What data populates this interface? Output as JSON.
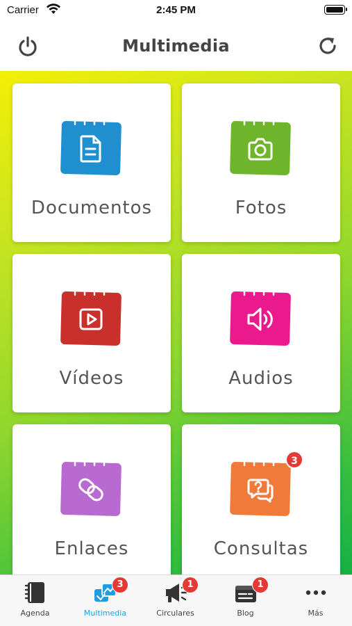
{
  "status_bar": {
    "carrier": "Carrier",
    "time": "2:45 PM"
  },
  "header": {
    "title": "Multimedia"
  },
  "tiles": [
    {
      "label": "Documentos",
      "color": "#1f8fcf",
      "icon": "document-icon"
    },
    {
      "label": "Fotos",
      "color": "#6fb52c",
      "icon": "camera-icon"
    },
    {
      "label": "Vídeos",
      "color": "#c9302c",
      "icon": "video-play-icon"
    },
    {
      "label": "Audios",
      "color": "#ea1a8c",
      "icon": "speaker-icon"
    },
    {
      "label": "Enlaces",
      "color": "#b96ad1",
      "icon": "link-icon"
    },
    {
      "label": "Consultas",
      "color": "#f07a3a",
      "icon": "question-chat-icon",
      "badge": "3"
    }
  ],
  "tab_bar": {
    "active_color": "#1e9ee0",
    "badge_color": "#e53935",
    "items": [
      {
        "label": "Agenda",
        "icon": "agenda-book-icon"
      },
      {
        "label": "Multimedia",
        "icon": "multimedia-icon",
        "badge": "3",
        "active": true
      },
      {
        "label": "Circulares",
        "icon": "megaphone-icon",
        "badge": "1"
      },
      {
        "label": "Blog",
        "icon": "blog-icon",
        "badge": "1"
      },
      {
        "label": "Más",
        "icon": "more-dots-icon"
      }
    ]
  }
}
